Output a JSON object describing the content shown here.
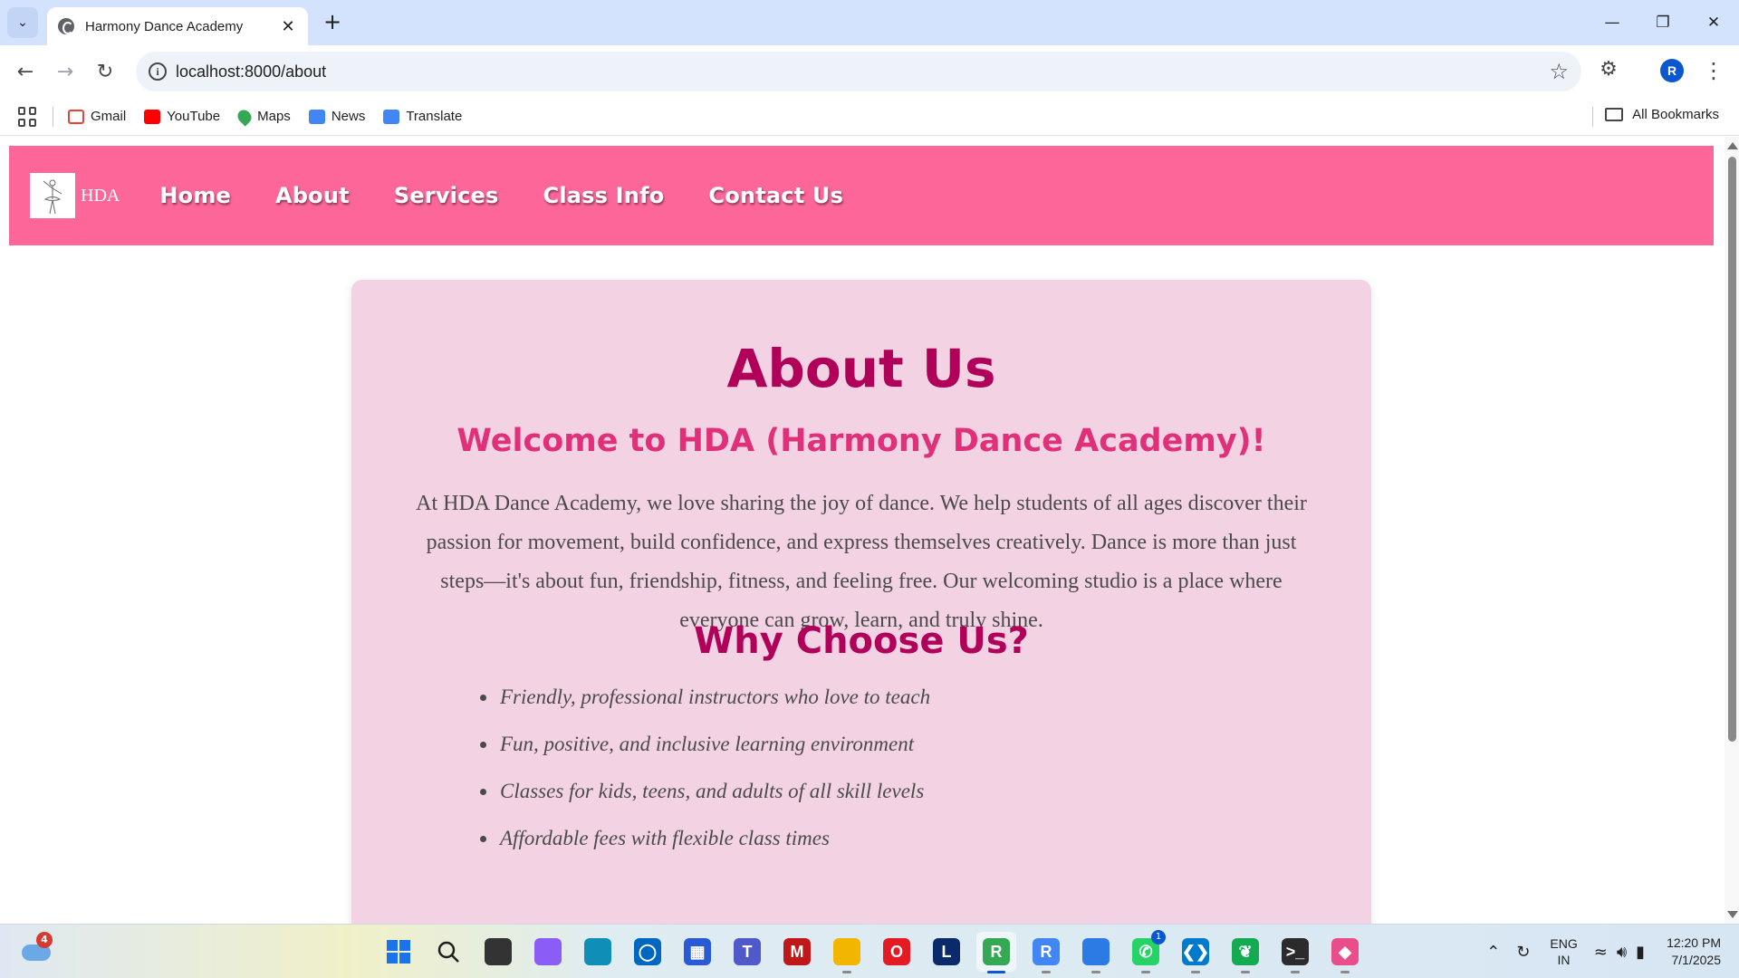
{
  "browser": {
    "tab_title": "Harmony Dance Academy",
    "url": "localhost:8000/about",
    "profile_initial": "R",
    "bookmarks": [
      {
        "label": "Gmail",
        "icon": "gmail-icon",
        "color": "#ea4335"
      },
      {
        "label": "YouTube",
        "icon": "youtube-icon",
        "color": "#ff0000"
      },
      {
        "label": "Maps",
        "icon": "maps-icon",
        "color": "#34a853"
      },
      {
        "label": "News",
        "icon": "news-icon",
        "color": "#4285f4"
      },
      {
        "label": "Translate",
        "icon": "translate-icon",
        "color": "#4285f4"
      }
    ],
    "all_bookmarks_label": "All Bookmarks"
  },
  "site": {
    "logo_text": "HDA",
    "nav": [
      "Home",
      "About",
      "Services",
      "Class Info",
      "Contact Us"
    ],
    "accent": "#fc6699"
  },
  "about": {
    "title": "About Us",
    "welcome": "Welcome to HDA (Harmony Dance Academy)!",
    "paragraph": "At HDA Dance Academy, we love sharing the joy of dance. We help students of all ages discover their passion for movement, build confidence, and express themselves creatively. Dance is more than just steps—it's about fun, friendship, fitness, and feeling free. Our welcoming studio is a place where everyone can grow, learn, and truly shine.",
    "why_title": "Why Choose Us?",
    "features": [
      "Friendly, professional instructors who love to teach",
      "Fun, positive, and inclusive learning environment",
      "Classes for kids, teens, and adults of all skill levels",
      "Affordable fees with flexible class times"
    ]
  },
  "taskbar": {
    "weather_badge": "4",
    "apps": [
      {
        "name": "start-icon",
        "color": "#1a73e8",
        "glyph": "⊞"
      },
      {
        "name": "search-icon",
        "color": "#e8eef5",
        "glyph": ""
      },
      {
        "name": "task-view-icon",
        "color": "#333333",
        "glyph": ""
      },
      {
        "name": "copilot-icon",
        "color": "#8b5cf6",
        "glyph": ""
      },
      {
        "name": "edge-icon",
        "color": "#0f8fb8",
        "glyph": ""
      },
      {
        "name": "app-icon",
        "color": "#0067c0",
        "glyph": "◯"
      },
      {
        "name": "store-icon",
        "color": "#2a5bd7",
        "glyph": "▦"
      },
      {
        "name": "teams-icon",
        "color": "#5059c9",
        "glyph": "T"
      },
      {
        "name": "mcafee-icon",
        "color": "#c01818",
        "glyph": "M"
      },
      {
        "name": "file-explorer-icon",
        "color": "#f2b600",
        "glyph": ""
      },
      {
        "name": "opera-icon",
        "color": "#e41b23",
        "glyph": "O"
      },
      {
        "name": "l-app-icon",
        "color": "#0a2a6b",
        "glyph": "L"
      },
      {
        "name": "chrome-icon",
        "color": "#34a853",
        "glyph": "R"
      },
      {
        "name": "chrome-profile-icon",
        "color": "#4285f4",
        "glyph": "R"
      },
      {
        "name": "photos-icon",
        "color": "#2c7be5",
        "glyph": ""
      },
      {
        "name": "whatsapp-icon",
        "color": "#25d366",
        "glyph": "✆"
      },
      {
        "name": "vscode-icon",
        "color": "#007acc",
        "glyph": "❮❯"
      },
      {
        "name": "mongodb-icon",
        "color": "#13aa52",
        "glyph": "❦"
      },
      {
        "name": "terminal-icon",
        "color": "#2b2b2b",
        "glyph": ">_"
      },
      {
        "name": "git-icon",
        "color": "#e94e8a",
        "glyph": "◆"
      }
    ],
    "lang_top": "ENG",
    "lang_bottom": "IN",
    "time": "12:20 PM",
    "date": "7/1/2025"
  }
}
